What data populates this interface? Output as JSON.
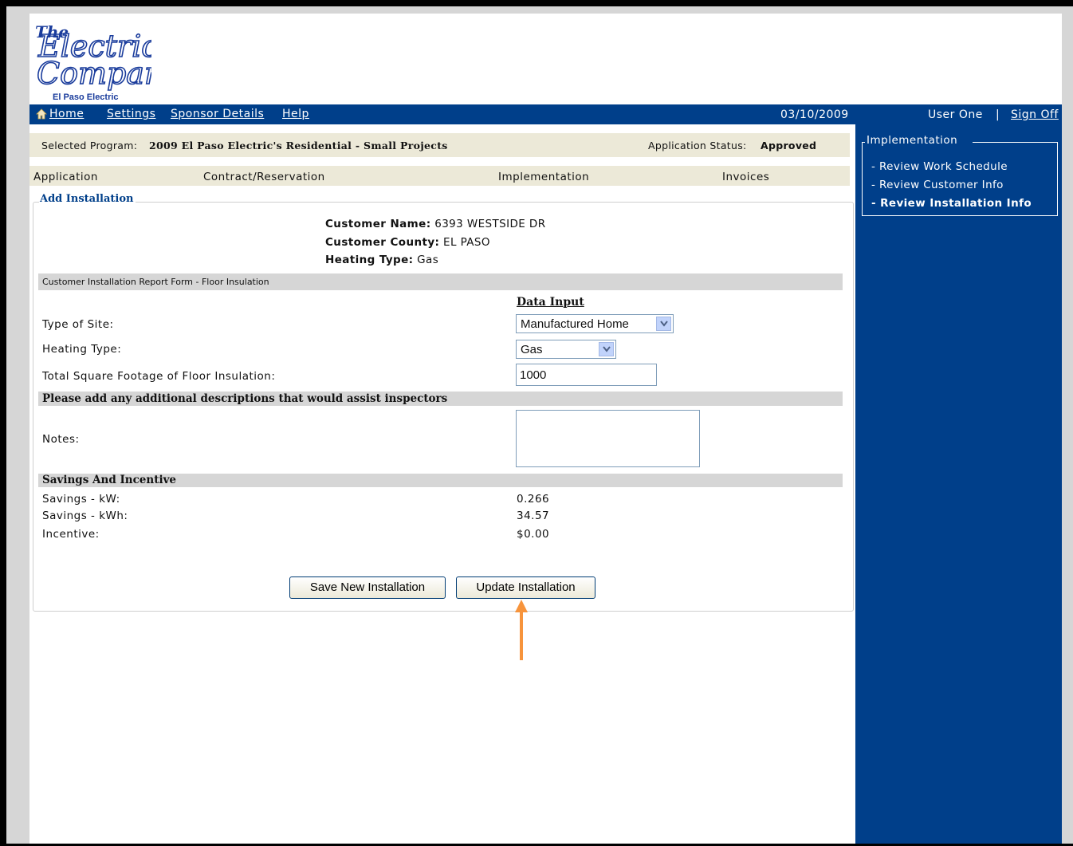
{
  "brand": {
    "logo_line1": "The",
    "logo_line2": "Electric",
    "logo_line3": "Company",
    "logo_sub": "El Paso Electric"
  },
  "nav": {
    "links": [
      "Home",
      "Settings",
      "Sponsor Details",
      "Help"
    ],
    "date": "03/10/2009",
    "user": "User One",
    "separator": "|",
    "sign_off": "Sign Off"
  },
  "sidebar": {
    "title": "Implementation",
    "items": [
      "- Review Work Schedule",
      "- Review Customer Info",
      "- Review Installation Info"
    ]
  },
  "program": {
    "selected_label": "Selected Program:",
    "selected_value": "2009 El Paso Electric's Residential - Small Projects",
    "status_label": "Application Status:",
    "status_value": "Approved"
  },
  "tabs": [
    "Application",
    "Contract/Reservation",
    "Implementation",
    "Invoices"
  ],
  "form": {
    "title": "Add Installation",
    "customer_name_label": "Customer Name:",
    "customer_name": "6393 WESTSIDE DR",
    "customer_county_label": "Customer County:",
    "customer_county": "EL PASO",
    "heating_type_label": "Heating Type:",
    "heating_type": "Gas",
    "report_section": "Customer Installation Report Form - Floor Insulation",
    "data_input_header": "Data Input",
    "type_of_site_label": "Type of Site:",
    "type_of_site_value": "Manufactured Home",
    "heating_type_field_label": "Heating Type:",
    "heating_type_field_value": "Gas",
    "sqft_label": "Total Square Footage of Floor Insulation:",
    "sqft_value": "1000",
    "descriptions_section": "Please add any additional descriptions that would assist inspectors",
    "notes_label": "Notes:",
    "notes_value": "",
    "savings_section": "Savings And Incentive",
    "savings_kw_label": "Savings - kW:",
    "savings_kw_value": "0.266",
    "savings_kwh_label": "Savings - kWh:",
    "savings_kwh_value": "34.57",
    "incentive_label": "Incentive:",
    "incentive_value": "$0.00",
    "save_button": "Save New Installation",
    "update_button": "Update Installation"
  },
  "colors": {
    "nav_blue": "#003f8a",
    "beige": "#ece9d8",
    "section_gray": "#d6d6d6",
    "annotation_orange": "#f7943c"
  }
}
